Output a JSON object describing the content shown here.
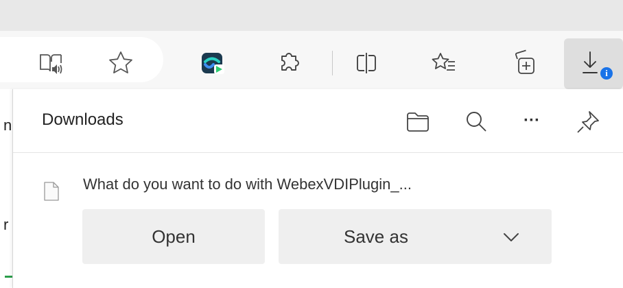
{
  "toolbar": {
    "icons": [
      "immersive-reader-icon",
      "favorite-star-icon",
      "webex-extension-icon",
      "extensions-puzzle-icon",
      "split-screen-icon",
      "favorites-list-icon",
      "collections-icon",
      "downloads-icon"
    ],
    "downloads_badge": "i"
  },
  "left_page": {
    "chars": [
      "n",
      "r"
    ]
  },
  "downloads_panel": {
    "title": "Downloads",
    "more_label": "···",
    "item": {
      "message": "What do you want to do with WebexVDIPlugin_...",
      "open_label": "Open",
      "save_as_label": "Save as"
    }
  },
  "colors": {
    "accent": "#0f6cbd",
    "badge": "#1a73e8",
    "webex_bg": "#1b3a4f",
    "webex_green": "#2ecc71"
  }
}
